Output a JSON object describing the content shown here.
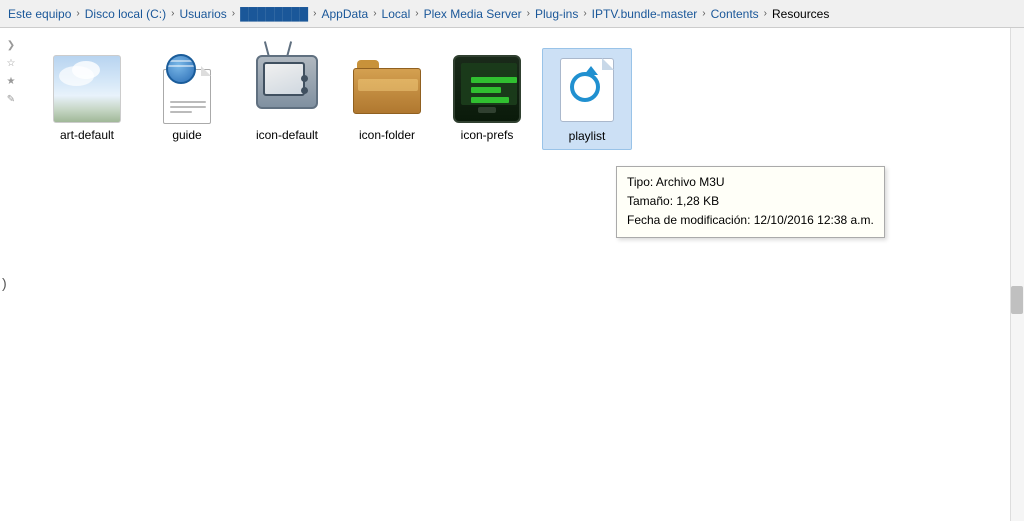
{
  "breadcrumb": {
    "items": [
      {
        "label": "Este equipo",
        "sep": true
      },
      {
        "label": "Disco local (C:)",
        "sep": true
      },
      {
        "label": "Usuarios",
        "sep": true
      },
      {
        "label": "████████",
        "sep": true
      },
      {
        "label": "AppData",
        "sep": true
      },
      {
        "label": "Local",
        "sep": true
      },
      {
        "label": "Plex Media Server",
        "sep": true
      },
      {
        "label": "Plug-ins",
        "sep": true
      },
      {
        "label": "IPTV.bundle-master",
        "sep": true
      },
      {
        "label": "Contents",
        "sep": true
      },
      {
        "label": "Resources",
        "sep": false
      }
    ]
  },
  "files": [
    {
      "name": "art-default",
      "type": "art"
    },
    {
      "name": "guide",
      "type": "guide"
    },
    {
      "name": "icon-default",
      "type": "tv"
    },
    {
      "name": "icon-folder",
      "type": "folder"
    },
    {
      "name": "icon-prefs",
      "type": "prefs"
    },
    {
      "name": "playlist",
      "type": "playlist",
      "selected": true
    }
  ],
  "tooltip": {
    "tipo_label": "Tipo:",
    "tipo_value": "Archivo M3U",
    "tamano_label": "Tamaño:",
    "tamano_value": "1,28 KB",
    "fecha_label": "Fecha de modificación:",
    "fecha_value": "12/10/2016 12:38 a.m."
  },
  "sidebar_icons": [
    "❯",
    "☆",
    "★",
    "✎"
  ]
}
